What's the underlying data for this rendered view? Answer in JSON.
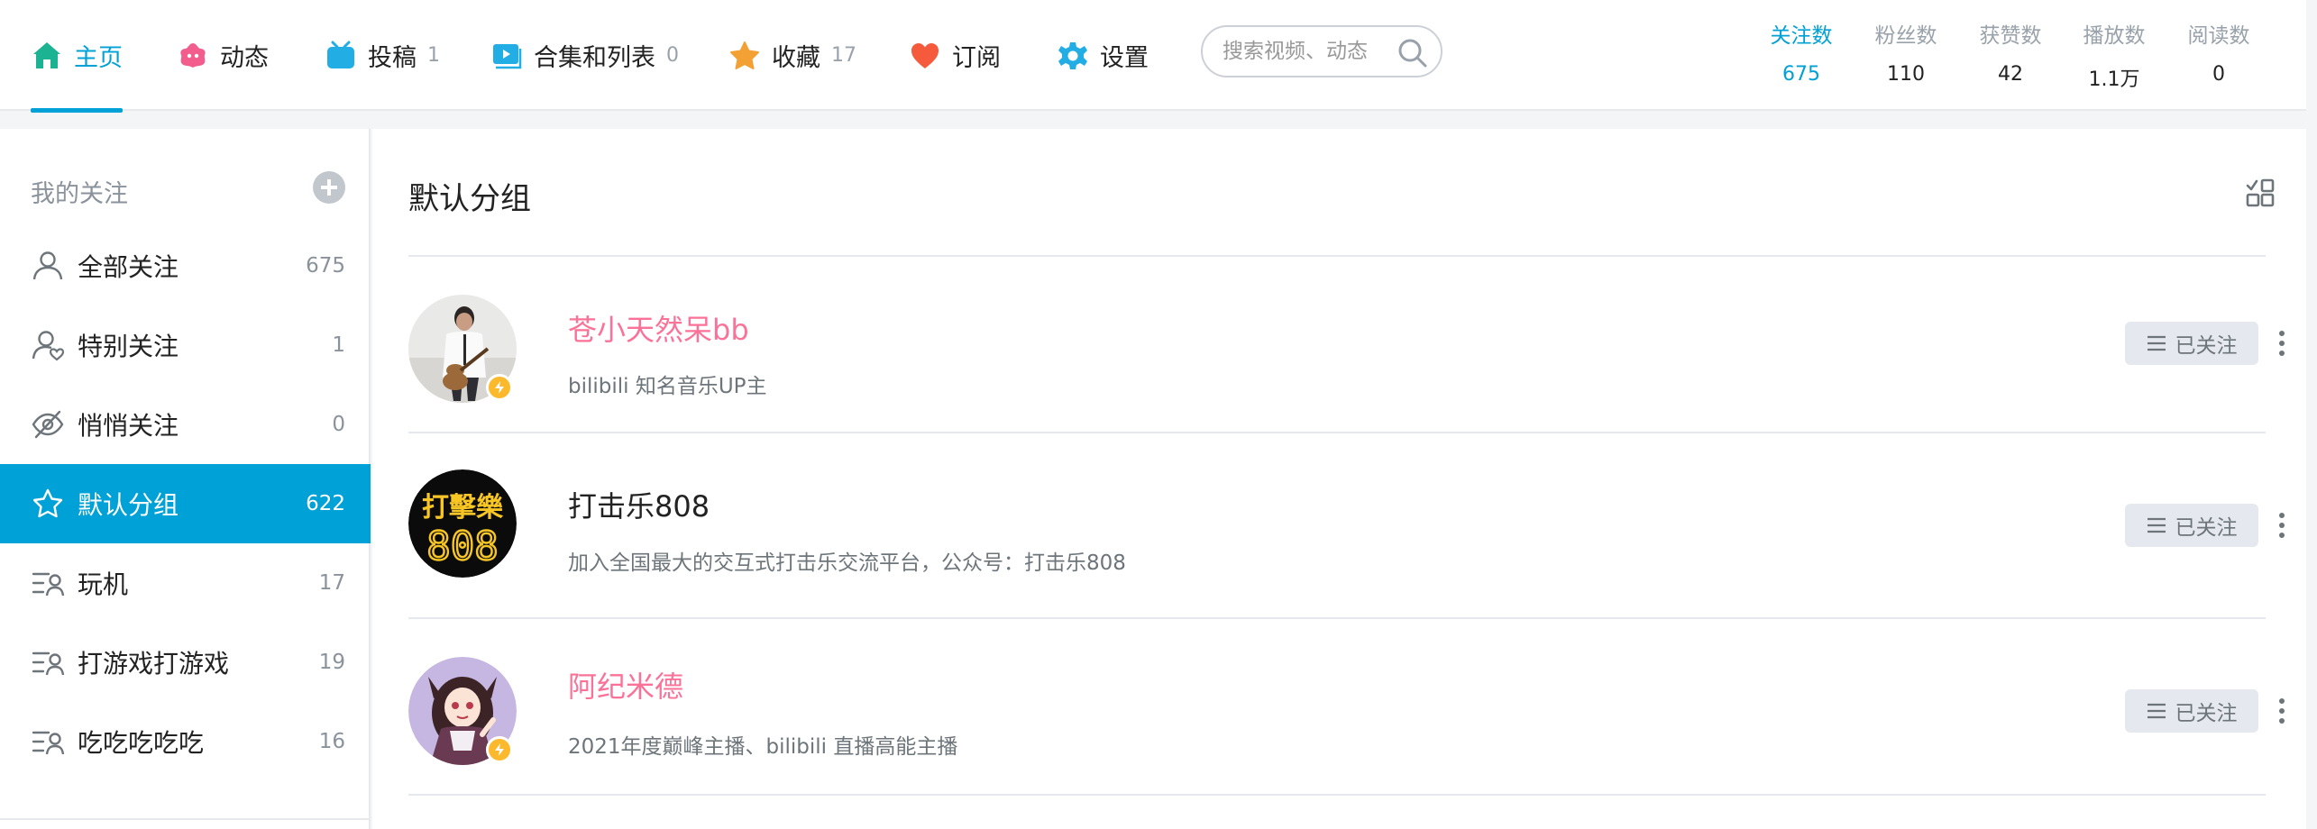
{
  "nav": {
    "items": [
      {
        "label": "主页",
        "count": ""
      },
      {
        "label": "动态",
        "count": ""
      },
      {
        "label": "投稿",
        "count": "1"
      },
      {
        "label": "合集和列表",
        "count": "0"
      },
      {
        "label": "收藏",
        "count": "17"
      },
      {
        "label": "订阅",
        "count": ""
      },
      {
        "label": "设置",
        "count": ""
      }
    ],
    "search_placeholder": "搜索视频、动态"
  },
  "stats": [
    {
      "label": "关注数",
      "value": "675"
    },
    {
      "label": "粉丝数",
      "value": "110"
    },
    {
      "label": "获赞数",
      "value": "42"
    },
    {
      "label": "播放数",
      "value": "1.1万"
    },
    {
      "label": "阅读数",
      "value": "0"
    }
  ],
  "sidebar": {
    "title": "我的关注",
    "items": [
      {
        "label": "全部关注",
        "count": "675",
        "icon": "user-icon"
      },
      {
        "label": "特别关注",
        "count": "1",
        "icon": "user-heart-icon"
      },
      {
        "label": "悄悄关注",
        "count": "0",
        "icon": "eye-off-icon"
      },
      {
        "label": "默认分组",
        "count": "622",
        "icon": "star-icon"
      },
      {
        "label": "玩机",
        "count": "17",
        "icon": "group-list-icon"
      },
      {
        "label": "打游戏打游戏",
        "count": "19",
        "icon": "group-list-icon"
      },
      {
        "label": "吃吃吃吃吃",
        "count": "16",
        "icon": "group-list-icon"
      }
    ]
  },
  "main": {
    "group_title": "默认分组",
    "follow_label": "已关注",
    "users": [
      {
        "name": "苍小天然呆bb",
        "desc": "bilibili 知名音乐UP主"
      },
      {
        "name": "打击乐808",
        "desc": "加入全国最大的交互式打击乐交流平台，公众号：打击乐808"
      },
      {
        "name": "阿纪米德",
        "desc": "2021年度巅峰主播、bilibili 直播高能主播"
      }
    ],
    "avatar_808_text": {
      "line1": "打擊樂",
      "line2": "808"
    }
  },
  "colors": {
    "accent": "#00a1d6",
    "vip_name": "#fb7299",
    "verify_badge": "#fbb92b"
  }
}
